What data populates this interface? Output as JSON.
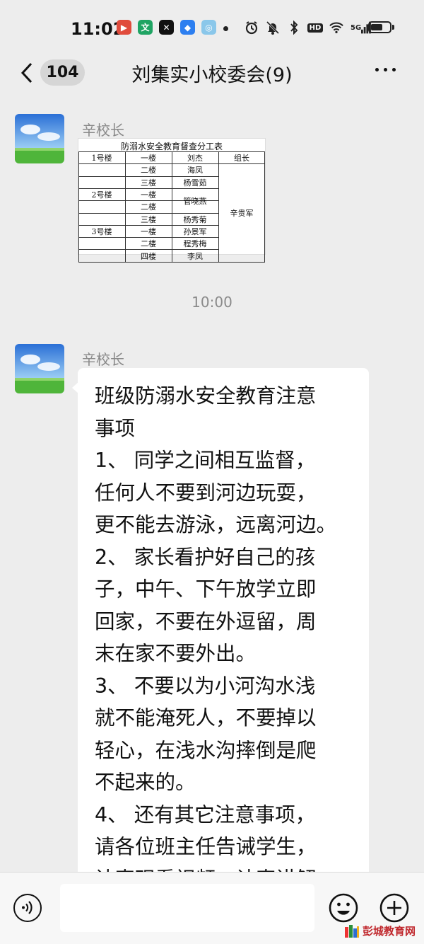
{
  "status_bar": {
    "time": "11:02",
    "apps": [
      {
        "icon": "app-icon-video",
        "glyph": "▶",
        "color": "#e04b3c"
      },
      {
        "icon": "app-icon-wen",
        "glyph": "文",
        "color": "#1fa463"
      },
      {
        "icon": "app-icon-capcut",
        "glyph": "✕",
        "color": "#111111"
      },
      {
        "icon": "app-icon-map",
        "glyph": "◆",
        "color": "#2d7ff0"
      },
      {
        "icon": "app-icon-browser",
        "glyph": "◎",
        "color": "#8ac7ea"
      }
    ],
    "network_label": "HD",
    "signal_label": "5G",
    "battery_level": 0.62
  },
  "nav": {
    "unread_count": "104",
    "title": "刘集实小校委会(9)"
  },
  "messages": [
    {
      "sender": "辛校长",
      "type": "image",
      "image": {
        "title": "防溺水安全教育督查分工表",
        "header_row": [
          "1号楼",
          "一楼",
          "刘杰",
          "组长"
        ],
        "rows": [
          {
            "building": "",
            "floor": "二楼",
            "name": "海凤"
          },
          {
            "building": "",
            "floor": "三楼",
            "name": "杨雪茹"
          },
          {
            "building": "2号楼",
            "floor": "一楼",
            "name": ""
          },
          {
            "building": "",
            "floor": "二楼",
            "name": ""
          },
          {
            "building": "",
            "floor": "三楼",
            "name": "杨秀菊"
          },
          {
            "building": "3号楼",
            "floor": "一楼",
            "name": "孙景军"
          },
          {
            "building": "",
            "floor": "二楼",
            "name": "程秀梅"
          },
          {
            "building": "",
            "floor": "四楼",
            "name": "李凤"
          }
        ],
        "merged_name": "管晓燕",
        "leader_name": "辛贵军"
      }
    },
    {
      "timestamp": "10:00"
    },
    {
      "sender": "辛校长",
      "type": "text",
      "lines": [
        "班级防溺水安全教育注意",
        "事项",
        "1、 同学之间相互监督，",
        "任何人不要到河边玩耍，",
        "更不能去游泳，远离河边。",
        "2、 家长看护好自己的孩",
        "子，中午、下午放学立即",
        "回家，不要在外逗留，周",
        "末在家不要外出。",
        "3、 不要以为小河沟水浅",
        "就不能淹死人，不要掉以",
        "轻心，在浅水沟摔倒是爬",
        "不起来的。",
        "4、 还有其它注意事项，",
        "请各位班主任告诫学生，",
        "认真观看视频，认真讲解。"
      ]
    }
  ],
  "input": {
    "placeholder": ""
  },
  "watermark": {
    "text": "彭城教育网"
  }
}
